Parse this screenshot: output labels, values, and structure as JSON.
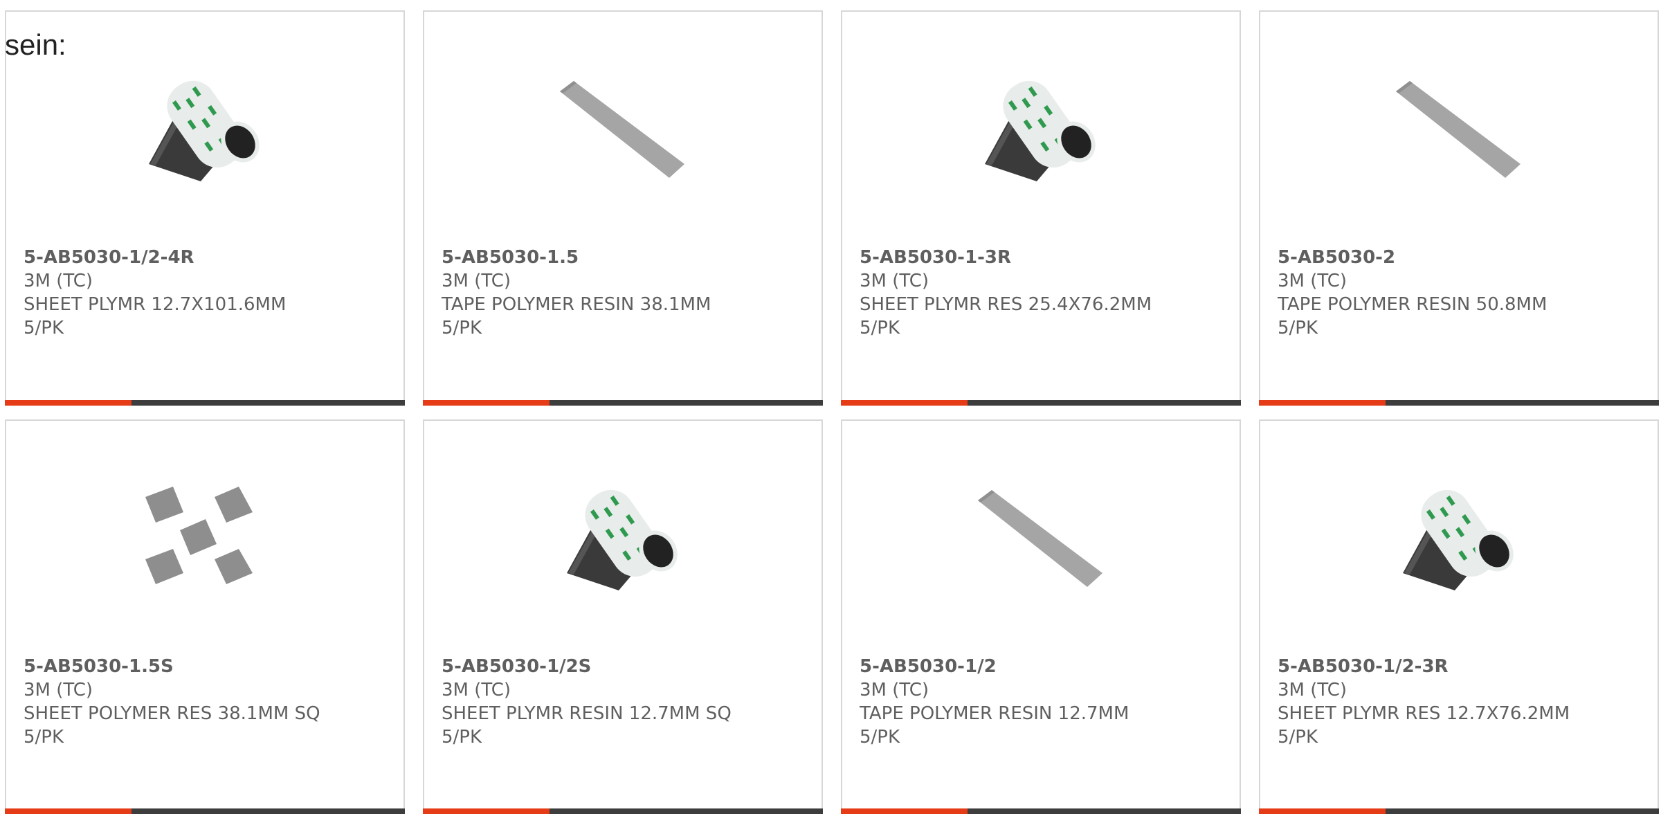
{
  "heading": "sein:",
  "colors": {
    "accent": "#e63b17",
    "bar": "#3d3d3d",
    "border": "#d7d7d7",
    "text": "#5f5f5f"
  },
  "products": [
    {
      "sku": "5-AB5030-1/2-4R",
      "brand": "3M (TC)",
      "description": "SHEET PLYMR 12.7X101.6MM",
      "pack": "5/PK",
      "image": "roll-sheet-image"
    },
    {
      "sku": "5-AB5030-1.5",
      "brand": "3M (TC)",
      "description": "TAPE POLYMER RESIN 38.1MM",
      "pack": "5/PK",
      "image": "tape-strip-image"
    },
    {
      "sku": "5-AB5030-1-3R",
      "brand": "3M (TC)",
      "description": "SHEET PLYMR RES 25.4X76.2MM",
      "pack": "5/PK",
      "image": "roll-sheet-image"
    },
    {
      "sku": "5-AB5030-2",
      "brand": "3M (TC)",
      "description": "TAPE POLYMER RESIN 50.8MM",
      "pack": "5/PK",
      "image": "tape-strip-image"
    },
    {
      "sku": "5-AB5030-1.5S",
      "brand": "3M (TC)",
      "description": "SHEET POLYMER RES 38.1MM SQ",
      "pack": "5/PK",
      "image": "square-pads-image"
    },
    {
      "sku": "5-AB5030-1/2S",
      "brand": "3M (TC)",
      "description": "SHEET PLYMR RESIN 12.7MM SQ",
      "pack": "5/PK",
      "image": "roll-sheet-image"
    },
    {
      "sku": "5-AB5030-1/2",
      "brand": "3M (TC)",
      "description": "TAPE POLYMER RESIN 12.7MM",
      "pack": "5/PK",
      "image": "tape-strip-image"
    },
    {
      "sku": "5-AB5030-1/2-3R",
      "brand": "3M (TC)",
      "description": "SHEET PLYMR RES 12.7X76.2MM",
      "pack": "5/PK",
      "image": "roll-sheet-image"
    }
  ]
}
